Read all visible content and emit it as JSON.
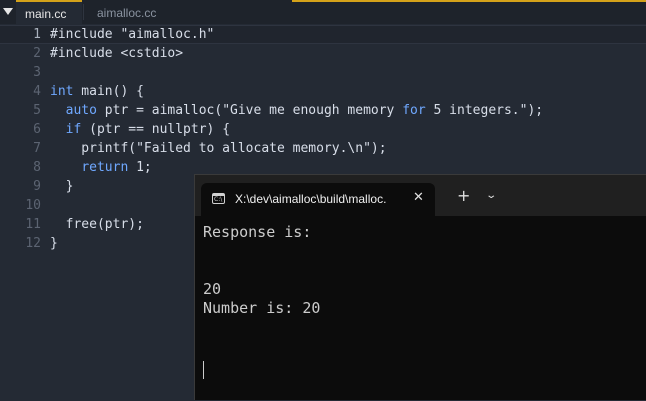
{
  "editor": {
    "tabs": [
      {
        "label": "main.cc",
        "active": true
      },
      {
        "label": "aimalloc.cc",
        "active": false
      }
    ],
    "lines": [
      {
        "n": "1",
        "parts": [
          {
            "t": "#include \"aimalloc.h\"",
            "c": "plain"
          }
        ]
      },
      {
        "n": "2",
        "parts": [
          {
            "t": "#include <cstdio>",
            "c": "plain"
          }
        ]
      },
      {
        "n": "3",
        "parts": []
      },
      {
        "n": "4",
        "parts": [
          {
            "t": "int",
            "c": "kw"
          },
          {
            "t": " main() {",
            "c": "plain"
          }
        ]
      },
      {
        "n": "5",
        "parts": [
          {
            "t": "  ",
            "c": "plain"
          },
          {
            "t": "auto",
            "c": "kw"
          },
          {
            "t": " ptr = aimalloc(\"Give me enough memory ",
            "c": "plain"
          },
          {
            "t": "for",
            "c": "kw"
          },
          {
            "t": " 5 integers.\");",
            "c": "plain"
          }
        ]
      },
      {
        "n": "6",
        "parts": [
          {
            "t": "  ",
            "c": "plain"
          },
          {
            "t": "if",
            "c": "kw"
          },
          {
            "t": " (ptr == nullptr) {",
            "c": "plain"
          }
        ]
      },
      {
        "n": "7",
        "parts": [
          {
            "t": "    printf(\"Failed to allocate memory.\\n\");",
            "c": "plain"
          }
        ]
      },
      {
        "n": "8",
        "parts": [
          {
            "t": "    ",
            "c": "plain"
          },
          {
            "t": "return",
            "c": "kw"
          },
          {
            "t": " 1;",
            "c": "plain"
          }
        ]
      },
      {
        "n": "9",
        "parts": [
          {
            "t": "  }",
            "c": "plain"
          }
        ]
      },
      {
        "n": "10",
        "parts": []
      },
      {
        "n": "11",
        "parts": [
          {
            "t": "  free(ptr);",
            "c": "plain"
          }
        ]
      },
      {
        "n": "12",
        "parts": [
          {
            "t": "}",
            "c": "plain"
          }
        ]
      }
    ],
    "current_line": "1",
    "colors": {
      "keyword": "#6fa8ff",
      "accent": "#d4a21a",
      "background": "#242a34"
    }
  },
  "terminal": {
    "tab_title": "X:\\dev\\aimalloc\\build\\malloc.",
    "icon": "terminal-icon",
    "output": [
      "Response is:",
      "",
      "",
      "20",
      "Number is: 20"
    ]
  }
}
